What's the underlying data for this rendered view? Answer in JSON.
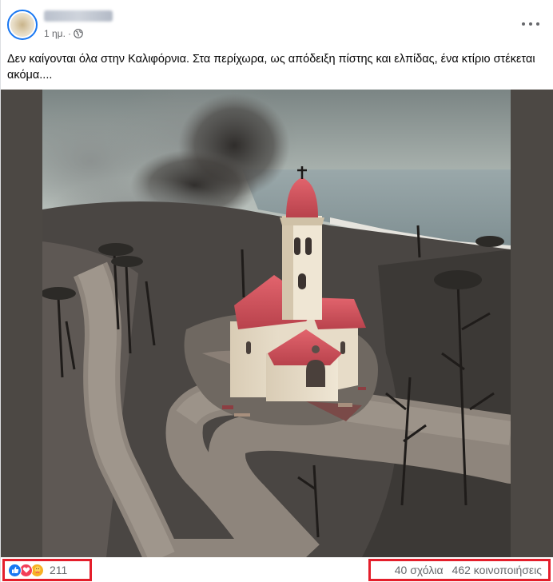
{
  "post": {
    "time": "1 ημ.",
    "separator": "·",
    "text": "Δεν καίγονται όλα στην Καλιφόρνια. Στα περίχωρα, ως απόδειξη πίστης και ελπίδας, ένα κτίριο στέκεται ακόμα...."
  },
  "icons": {
    "privacy": "globe-icon",
    "menu": "more-options-icon",
    "reactions": [
      "like-icon",
      "love-icon",
      "care-icon"
    ]
  },
  "footer": {
    "reaction_count": "211",
    "comments": "40 σχόλια",
    "shares": "462 κοινοποιήσεις"
  },
  "colors": {
    "facebook_blue": "#1877f2",
    "love_red": "#f33e58",
    "care_yellow": "#f7b125",
    "highlight_red": "#e41e2b",
    "church_roof": "#d8505a"
  }
}
